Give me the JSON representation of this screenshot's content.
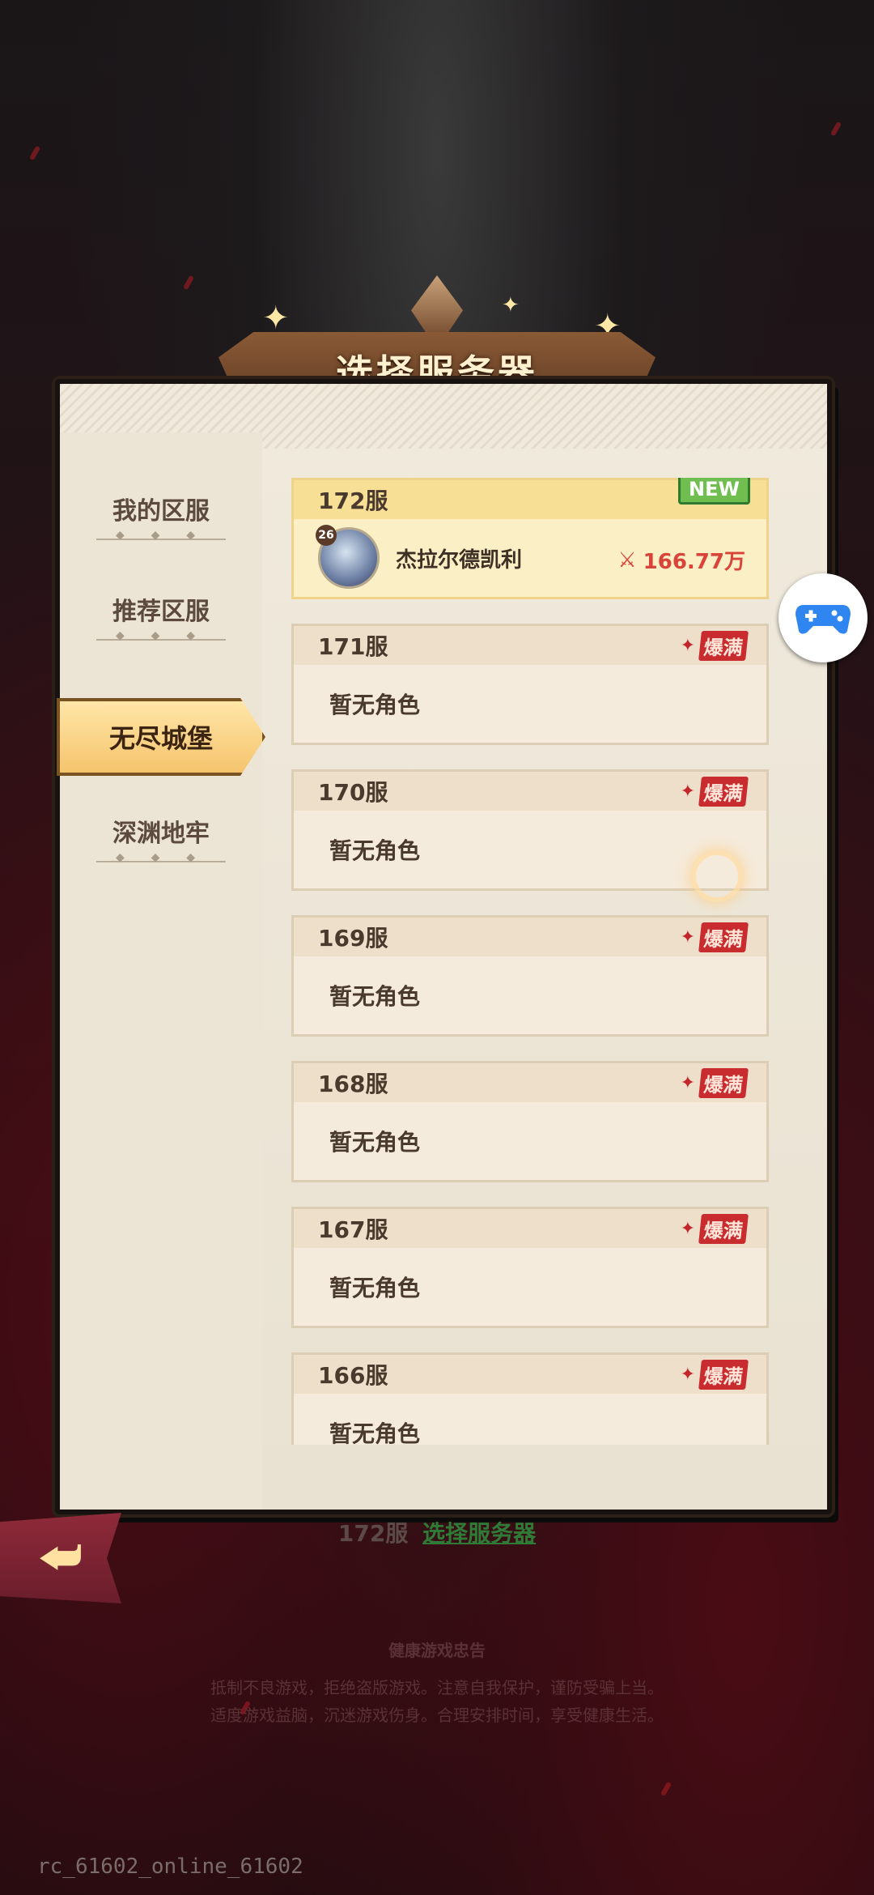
{
  "title": "选择服务器",
  "sidebar": {
    "items": [
      {
        "label": "我的区服"
      },
      {
        "label": "推荐区服"
      },
      {
        "label": "无尽城堡",
        "active": true
      },
      {
        "label": "深渊地牢"
      }
    ]
  },
  "servers": [
    {
      "name": "172服",
      "new_badge": "NEW",
      "role_level": "26",
      "role_name": "杰拉尔德凯利",
      "power": "166.77万"
    },
    {
      "name": "171服",
      "status": "爆满",
      "body": "暂无角色"
    },
    {
      "name": "170服",
      "status": "爆满",
      "body": "暂无角色"
    },
    {
      "name": "169服",
      "status": "爆满",
      "body": "暂无角色"
    },
    {
      "name": "168服",
      "status": "爆满",
      "body": "暂无角色"
    },
    {
      "name": "167服",
      "status": "爆满",
      "body": "暂无角色"
    },
    {
      "name": "166服",
      "status": "爆满",
      "body": "暂无角色"
    }
  ],
  "footer": {
    "current_server": "172服",
    "select_link": "选择服务器"
  },
  "notice": {
    "title": "健康游戏忠告",
    "line1": "抵制不良游戏，拒绝盗版游戏。注意自我保护，谨防受骗上当。",
    "line2": "适度游戏益脑，沉迷游戏伤身。合理安排时间，享受健康生活。"
  },
  "version": "rc_61602_online_61602",
  "colors": {
    "accent_gold": "#f5c46d",
    "full_red": "#c92c2f",
    "link_green": "#2f7a36"
  }
}
